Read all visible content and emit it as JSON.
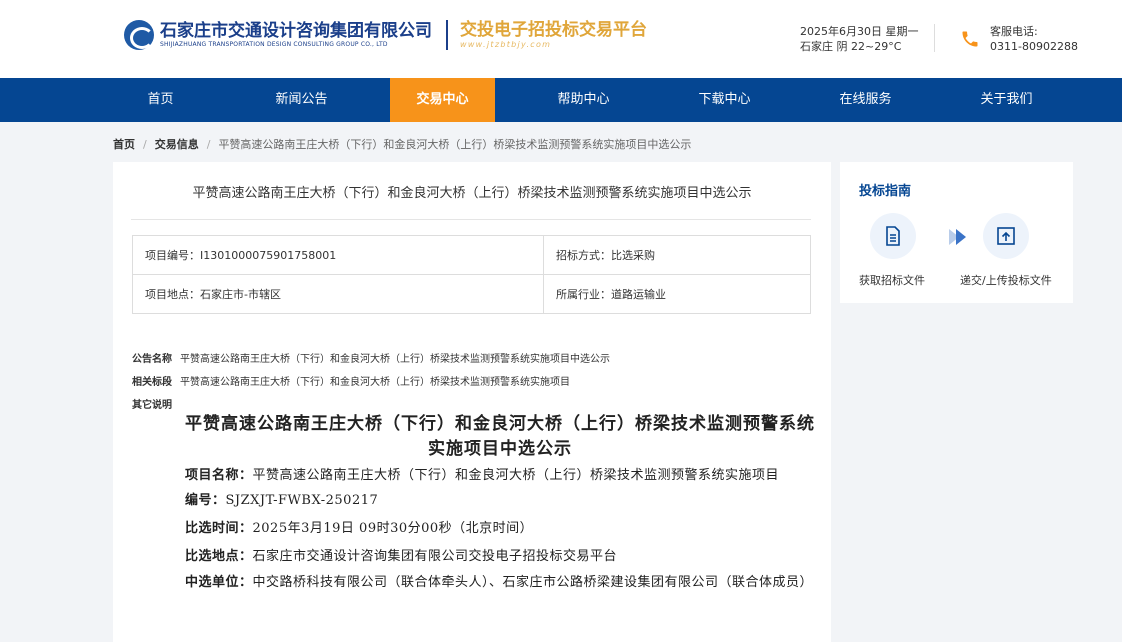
{
  "header": {
    "logo_cn": "石家庄市交通设计咨询集团有限公司",
    "logo_en": "SHIJIAZHUANG TRANSPORTATION DESIGN CONSULTING GROUP CO., LTD",
    "platform_name": "交投电子招投标交易平台",
    "platform_url": "www.jtzbtbjy.com",
    "date": "2025年6月30日 星期一",
    "weather": "石家庄 阴 22~29°C",
    "service_label": "客服电话:",
    "service_phone": "0311-80902288"
  },
  "nav": {
    "items": [
      "首页",
      "新闻公告",
      "交易中心",
      "帮助中心",
      "下载中心",
      "在线服务",
      "关于我们"
    ],
    "active": "交易中心"
  },
  "breadcrumb": {
    "home": "首页",
    "section": "交易信息",
    "current": "平赞高速公路南王庄大桥（下行）和金良河大桥（上行）桥梁技术监测预警系统实施项目中选公示"
  },
  "notice": {
    "title": "平赞高速公路南王庄大桥（下行）和金良河大桥（上行）桥梁技术监测预警系统实施项目中选公示",
    "project_no": "项目编号：I1301000075901758001",
    "method": "招标方式：比选采购",
    "location": "项目地点：石家庄市-市辖区",
    "industry": "所属行业：道路运输业",
    "name_label": "公告名称",
    "name_value": "平赞高速公路南王庄大桥（下行）和金良河大桥（上行）桥梁技术监测预警系统实施项目中选公示",
    "section_label": "相关标段",
    "section_value": "平赞高速公路南王庄大桥（下行）和金良河大桥（上行）桥梁技术监测预警系统实施项目",
    "other_label": "其它说明"
  },
  "document": {
    "title": "平赞高速公路南王庄大桥（下行）和金良河大桥（上行）桥梁技术监测预警系统实施项目中选公示",
    "project_name_label": "项目名称：",
    "project_name": "平赞高速公路南王庄大桥（下行）和金良河大桥（上行）桥梁技术监测预警系统实施项目",
    "code_label": "编号：",
    "code": "SJZXJT-FWBX-250217",
    "time_label": "比选时间：",
    "time": "2025年3月19日 09时30分00秒（北京时间）",
    "place_label": "比选地点：",
    "place": "石家庄市交通设计咨询集团有限公司交投电子招投标交易平台",
    "winner_label": "中选单位：",
    "winner": "中交路桥科技有限公司（联合体牵头人）、石家庄市公路桥梁建设集团有限公司（联合体成员）"
  },
  "side": {
    "title": "投标指南",
    "step1": "获取招标文件",
    "step2": "递交/上传投标文件"
  },
  "colors": {
    "nav_bg": "#054692",
    "nav_active": "#f7931a",
    "brand_blue": "#1b3f8a",
    "platform_gold": "#e0a63a"
  }
}
